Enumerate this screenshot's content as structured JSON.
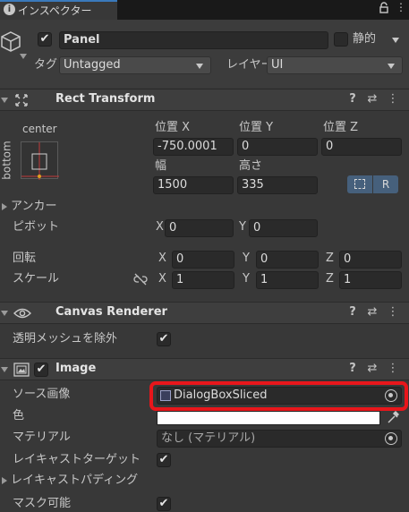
{
  "tab": {
    "label": "インスペクター"
  },
  "object": {
    "name": "Panel",
    "static_label": "静的",
    "tag_label": "タグ",
    "tag_value": "Untagged",
    "layer_label": "レイヤー",
    "layer_value": "UI"
  },
  "rect_transform": {
    "title": "Rect Transform",
    "anchor_h": "center",
    "anchor_v": "bottom",
    "pos_x_label": "位置 X",
    "pos_y_label": "位置 Y",
    "pos_z_label": "位置 Z",
    "pos_x": "-750.0001",
    "pos_y": "0",
    "pos_z": "0",
    "width_label": "幅",
    "height_label": "高さ",
    "width": "1500",
    "height": "335",
    "raw_label": "R",
    "anchors_label": "アンカー",
    "pivot_label": "ピボット",
    "pivot_x": "0",
    "pivot_y": "0",
    "rotation_label": "回転",
    "rot_x": "0",
    "rot_y": "0",
    "rot_z": "0",
    "scale_label": "スケール",
    "scale_x": "1",
    "scale_y": "1",
    "scale_z": "1",
    "x": "X",
    "y": "Y",
    "z": "Z"
  },
  "canvas_renderer": {
    "title": "Canvas Renderer",
    "cull_label": "透明メッシュを除外"
  },
  "image": {
    "title": "Image",
    "source_label": "ソース画像",
    "source_value": "DialogBoxSliced",
    "color_label": "色",
    "color_value": "#ffffff",
    "material_label": "マテリアル",
    "material_value": "なし (マテリアル)",
    "raycast_target_label": "レイキャストターゲット",
    "raycast_padding_label": "レイキャストパディング",
    "maskable_label": "マスク可能"
  },
  "colors": {
    "highlight": "#e8161b",
    "panel_bg": "#383838",
    "header_bg": "#3e3e3e",
    "field_bg": "#2a2a2a",
    "tab_bg": "#282828"
  }
}
